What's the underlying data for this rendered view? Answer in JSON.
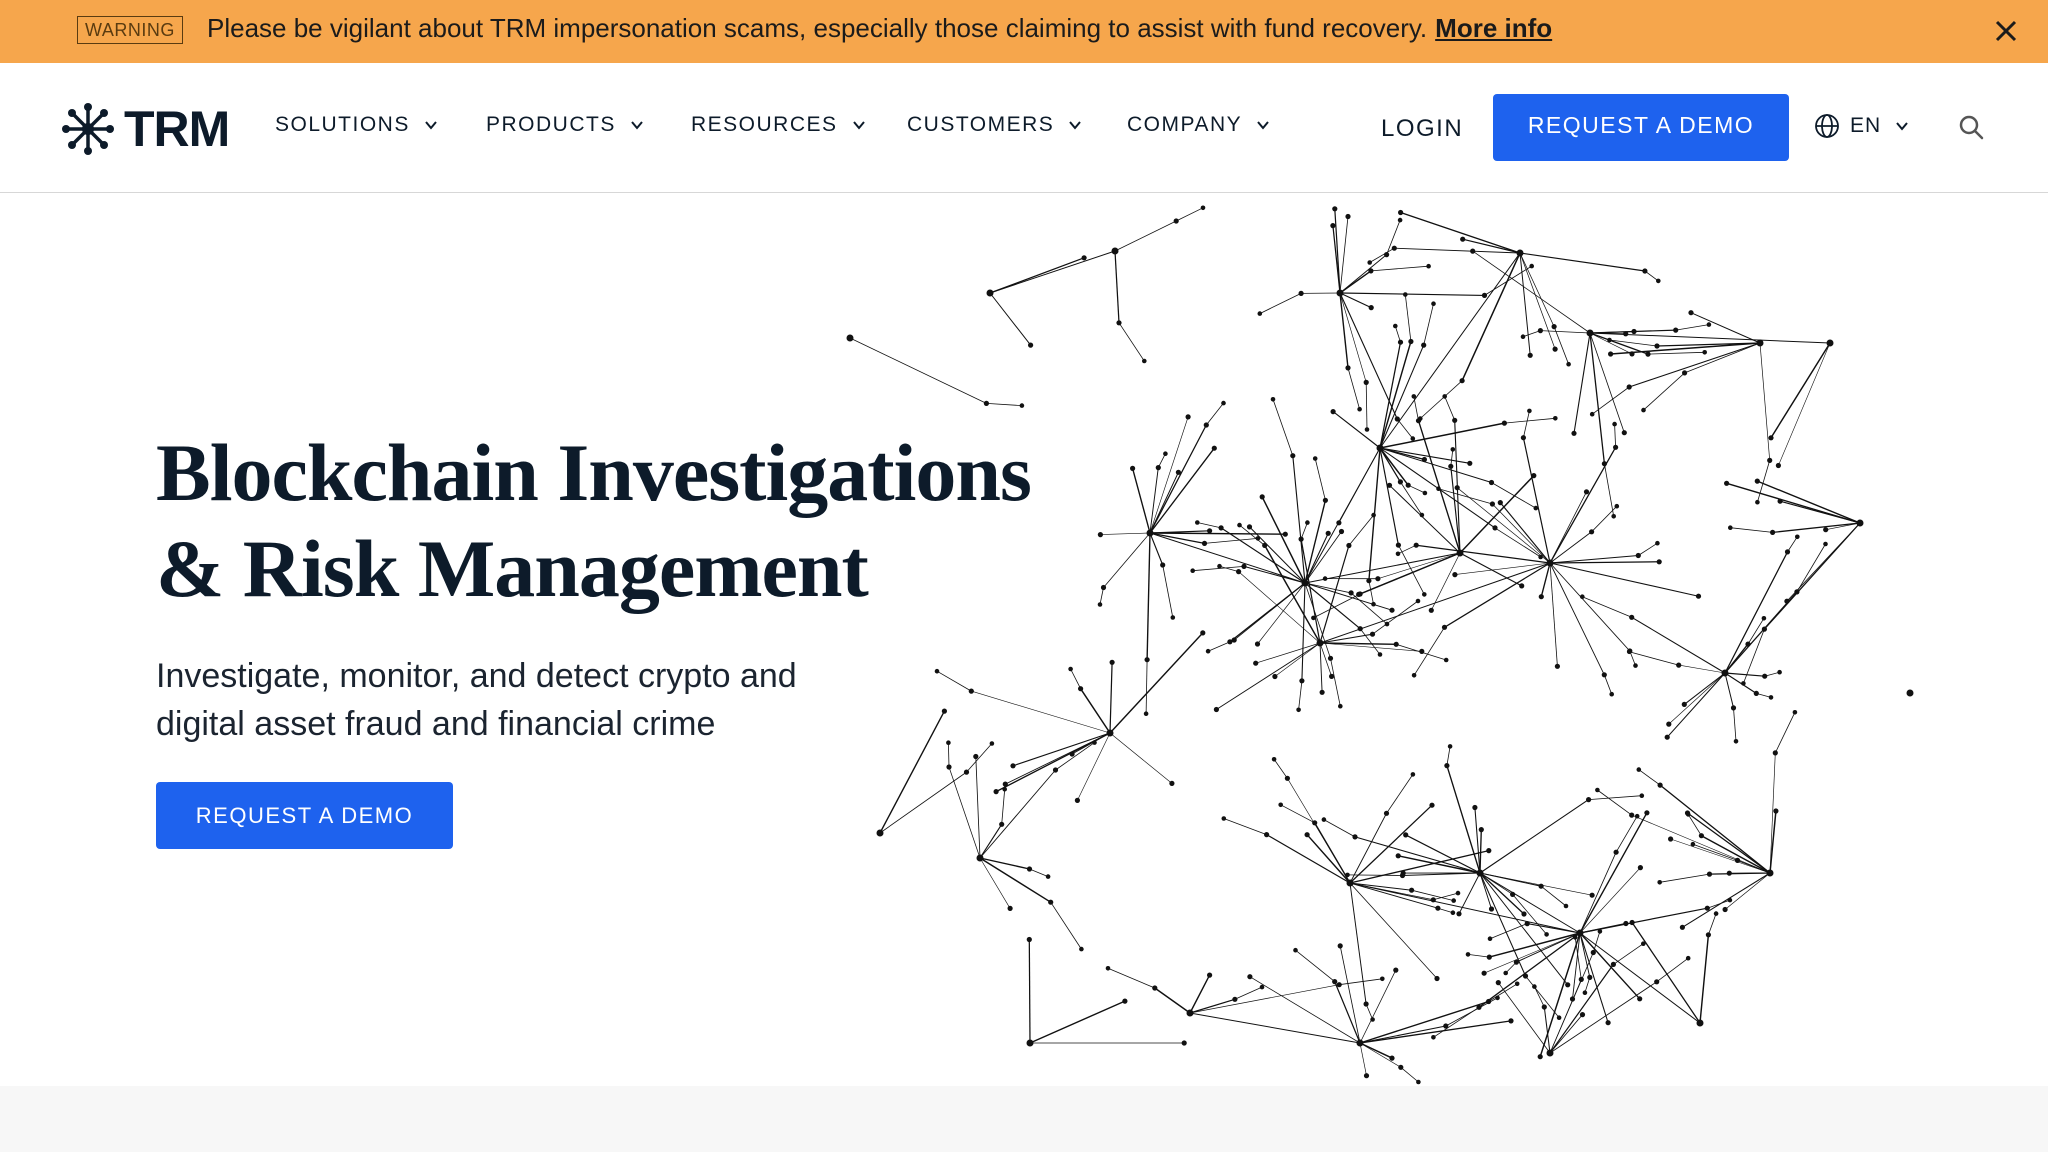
{
  "banner": {
    "badge": "WARNING",
    "message": "Please be vigilant about TRM impersonation scams, especially those claiming to assist with fund recovery.",
    "link": "More info",
    "close_icon": "close-icon",
    "background": "#f6a64c"
  },
  "header": {
    "logo_text": "TRM",
    "logo_icon": "asterisk-network-icon",
    "nav": [
      {
        "label": "SOLUTIONS"
      },
      {
        "label": "PRODUCTS"
      },
      {
        "label": "RESOURCES"
      },
      {
        "label": "CUSTOMERS"
      },
      {
        "label": "COMPANY"
      }
    ],
    "login": "LOGIN",
    "demo_button": "REQUEST A DEMO",
    "language": "EN",
    "globe_icon": "globe-icon",
    "search_icon": "search-icon"
  },
  "hero": {
    "title_line1": "Blockchain Investigations",
    "title_line2": "& Risk Management",
    "subtitle_line1": "Investigate, monitor, and detect crypto and",
    "subtitle_line2": "digital asset fraud and financial crime",
    "cta": "REQUEST A DEMO",
    "illustration": "network-graph-illustration"
  },
  "colors": {
    "primary": "#1e62ee",
    "text": "#0d1b2a",
    "warning": "#f6a64c"
  }
}
